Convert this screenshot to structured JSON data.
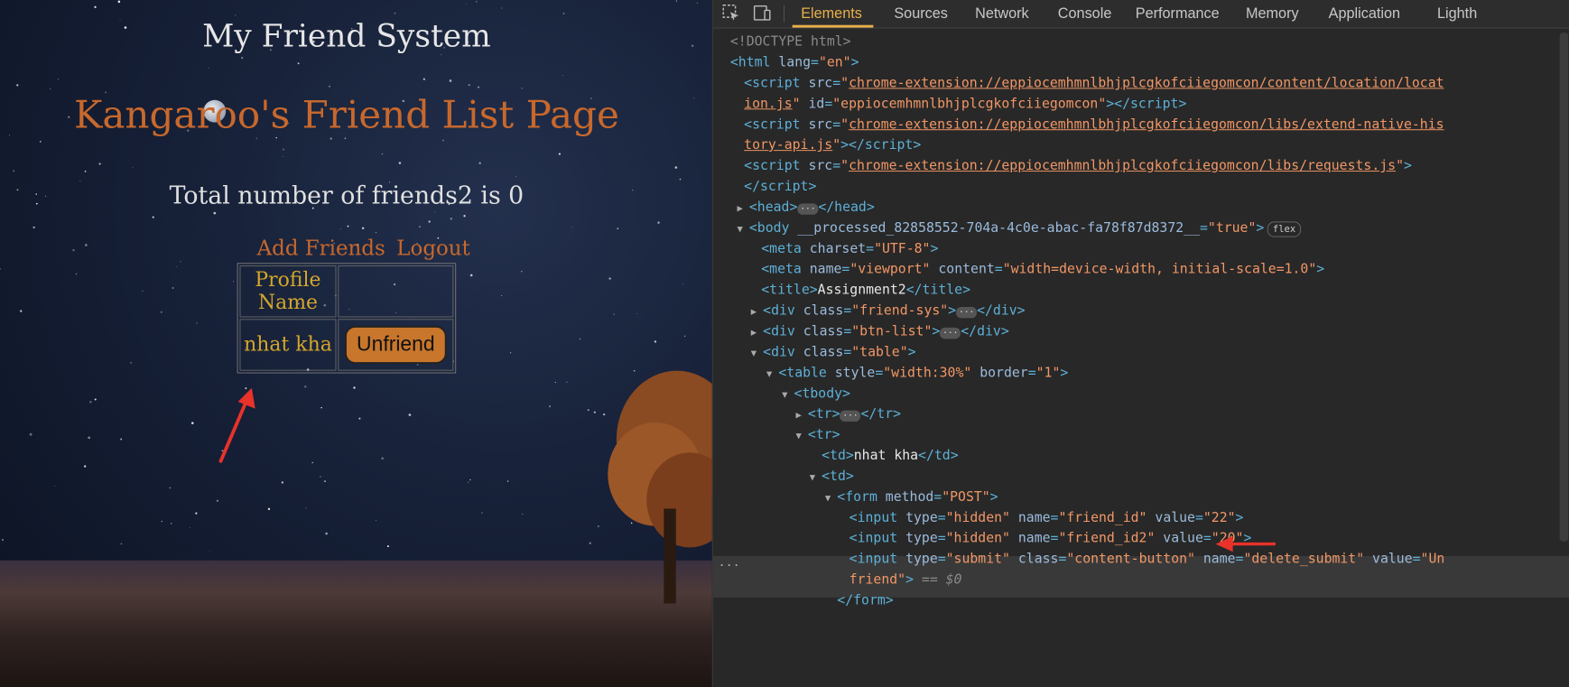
{
  "preview": {
    "site_title": "My Friend System",
    "heading": "Kangaroo's Friend List Page",
    "friend_count": "Total number of friends2 is 0",
    "nav": {
      "add_friends": "Add Friends",
      "logout": "Logout"
    },
    "table": {
      "header": "Profile Name",
      "rows": [
        {
          "name": "nhat kha",
          "action": "Unfriend"
        }
      ]
    }
  },
  "devtools": {
    "tabs": [
      "Elements",
      "Sources",
      "Network",
      "Console",
      "Performance",
      "Memory",
      "Application",
      "Lighth"
    ],
    "active_tab": "Elements",
    "dom": {
      "doctype": "<!DOCTYPE html>",
      "l1": "<html",
      "l1_attr": "lang",
      "l1_val": "\"en\"",
      "s1_link": "chrome-extension://eppiocemhmnlbhjplcgkofciiegomcon/content/location/locat",
      "s1_cont_link": "ion.js",
      "s1_id_val": "\"eppiocemhmnlbhjplcgkofciiegomcon\"",
      "s2_link": "chrome-extension://eppiocemhmnlbhjplcgkofciiegomcon/libs/extend-native-his",
      "s2_cont_link": "tory-api.js",
      "s3_link": "chrome-extension://eppiocemhmnlbhjplcgkofciiegomcon/libs/requests.js",
      "body_attr": "__processed_82858552-704a-4c0e-abac-fa78f87d8372__",
      "body_val": "\"true\"",
      "body_badge": "flex",
      "meta_charset": "\"UTF-8\"",
      "meta_viewport_content": "\"width=device-width, initial-scale=1.0\"",
      "title_text": "Assignment2",
      "div1_class": "\"friend-sys\"",
      "div2_class": "\"btn-list\"",
      "div3_class": "\"table\"",
      "table_style": "\"width:30%\"",
      "table_border": "\"1\"",
      "td_text": "nhat kha",
      "form_method": "\"POST\"",
      "in1_name": "\"friend_id\"",
      "in1_value": "\"22\"",
      "in2_name": "\"friend_id2\"",
      "in2_value": "\"20\"",
      "in3_class": "\"content-button\"",
      "in3_name": "\"delete_submit\"",
      "in3_value_a": "\"Un",
      "in3_value_b": "friend\"",
      "eq0": "== $0",
      "gutter": "···"
    }
  }
}
